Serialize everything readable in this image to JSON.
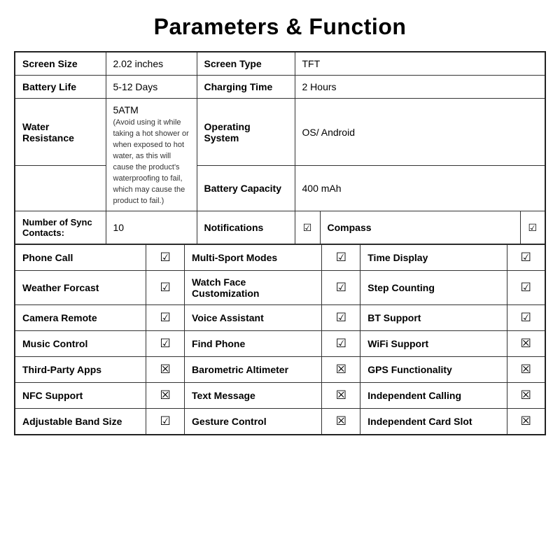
{
  "title": "Parameters & Function",
  "specs": {
    "screen_size_label": "Screen Size",
    "screen_size_value": "2.02 inches",
    "screen_type_label": "Screen Type",
    "screen_type_value": "TFT",
    "battery_life_label": "Battery Life",
    "battery_life_value": "5-12 Days",
    "charging_time_label": "Charging Time",
    "charging_time_value": "2 Hours",
    "water_resistance_label": "Water Resistance",
    "water_resistance_value": "5ATM",
    "water_resistance_note": "(Avoid using it while taking a hot shower or when exposed to hot water, as this will cause the product's waterproofing to fail, which may cause the product to fail.)",
    "operating_system_label": "Operating System",
    "operating_system_value": "OS/ Android",
    "battery_capacity_label": "Battery Capacity",
    "battery_capacity_value": "400 mAh",
    "sync_contacts_label": "Number of Sync Contacts:",
    "sync_contacts_value": "10"
  },
  "features": [
    {
      "left_label": "Phone Call",
      "left_check": "☑",
      "mid_label": "Multi-Sport Modes",
      "mid_check": "☑",
      "right_label": "Time Display",
      "right_check": "☑"
    },
    {
      "left_label": "Weather Forcast",
      "left_check": "☑",
      "mid_label": "Watch Face Customization",
      "mid_check": "☑",
      "right_label": "Step Counting",
      "right_check": "☑"
    },
    {
      "left_label": "Camera Remote",
      "left_check": "☑",
      "mid_label": "Voice Assistant",
      "mid_check": "☑",
      "right_label": "BT Support",
      "right_check": "☑"
    },
    {
      "left_label": "Music Control",
      "left_check": "☑",
      "mid_label": "Find Phone",
      "mid_check": "☑",
      "right_label": "WiFi Support",
      "right_check": "☒"
    },
    {
      "left_label": "Third-Party Apps",
      "left_check": "☒",
      "mid_label": "Barometric Altimeter",
      "mid_check": "☒",
      "right_label": "GPS Functionality",
      "right_check": "☒"
    },
    {
      "left_label": "NFC Support",
      "left_check": "☒",
      "mid_label": "Text Message",
      "mid_check": "☒",
      "right_label": "Independent Calling",
      "right_check": "☒"
    },
    {
      "left_label": "Adjustable Band Size",
      "left_check": "☑",
      "mid_label": "Gesture Control",
      "mid_check": "☒",
      "right_label": "Independent Card Slot",
      "right_check": "☒"
    }
  ],
  "notifications_label": "Notifications",
  "notifications_check": "☑",
  "compass_label": "Compass",
  "compass_check": "☑"
}
